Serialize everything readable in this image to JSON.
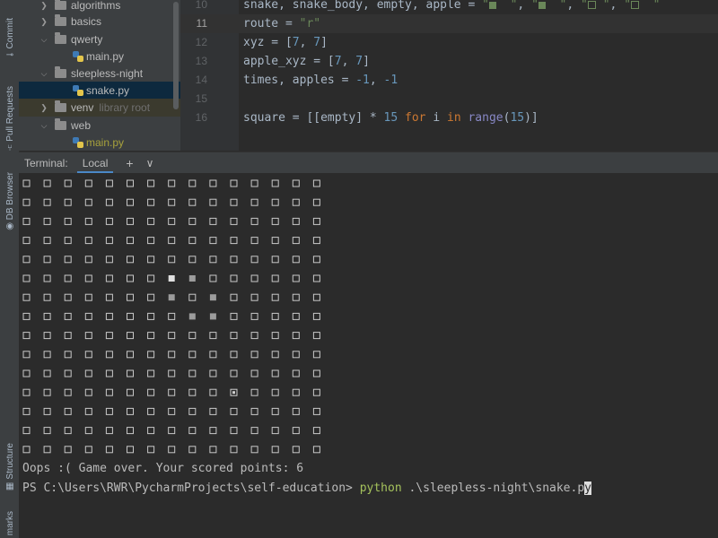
{
  "sidebar": {
    "tabs": [
      {
        "label": "Commit",
        "icon": "commit-icon"
      },
      {
        "label": "Pull Requests",
        "icon": "pull-requests-icon"
      },
      {
        "label": "DB Browser",
        "icon": "db-browser-icon"
      },
      {
        "label": "Structure",
        "icon": "structure-icon"
      },
      {
        "label": "marks",
        "icon": "bookmarks-icon"
      }
    ]
  },
  "project_tree": {
    "items": [
      {
        "label": "algorithms",
        "kind": "folder",
        "expanded": false
      },
      {
        "label": "basics",
        "kind": "folder",
        "expanded": false
      },
      {
        "label": "qwerty",
        "kind": "folder",
        "expanded": true
      },
      {
        "label": "main.py",
        "kind": "file"
      },
      {
        "label": "sleepless-night",
        "kind": "folder",
        "expanded": true
      },
      {
        "label": "snake.py",
        "kind": "file",
        "selected": true
      },
      {
        "label": "venv",
        "kind": "folder",
        "expanded": false,
        "note": "library root"
      },
      {
        "label": "web",
        "kind": "folder",
        "expanded": true
      },
      {
        "label": "main.py",
        "kind": "file"
      }
    ]
  },
  "editor": {
    "lines": [
      {
        "n": "10",
        "text": "snake, snake_body, empty, apple = \"▪ \", \"▪ \", \"□ \", \"▣ \""
      },
      {
        "n": "11",
        "text": "route = \"r\"",
        "current": true
      },
      {
        "n": "12",
        "text": "xyz = [7, 7]"
      },
      {
        "n": "13",
        "text": "apple_xyz = [7, 7]"
      },
      {
        "n": "14",
        "text": "times, apples = -1, -1"
      },
      {
        "n": "15",
        "text": ""
      },
      {
        "n": "16",
        "text": "square = [[empty] * 15 for i in range(15)]"
      }
    ]
  },
  "terminal": {
    "title": "Terminal:",
    "tab": "Local",
    "add_label": "+",
    "dropdown_label": "∨",
    "grid": {
      "size": 15,
      "empty_symbol": "□",
      "snake_head": [
        [
          5,
          7
        ]
      ],
      "snake_body": [
        [
          5,
          8
        ],
        [
          6,
          7
        ],
        [
          6,
          9
        ],
        [
          7,
          8
        ],
        [
          7,
          9
        ]
      ],
      "apple": [
        [
          11,
          10
        ]
      ]
    },
    "output": "Oops :( Game over. Your scored points: 6",
    "prompt": "PS C:\\Users\\RWR\\PycharmProjects\\self-education> ",
    "command": "python",
    "args": " .\\sleepless-night\\snake.p",
    "cursor_char": "y"
  },
  "colors": {
    "accent": "#4a88c7",
    "string": "#6a8759",
    "number": "#6897bb",
    "keyword": "#cc7832",
    "command": "#a5c25c"
  }
}
